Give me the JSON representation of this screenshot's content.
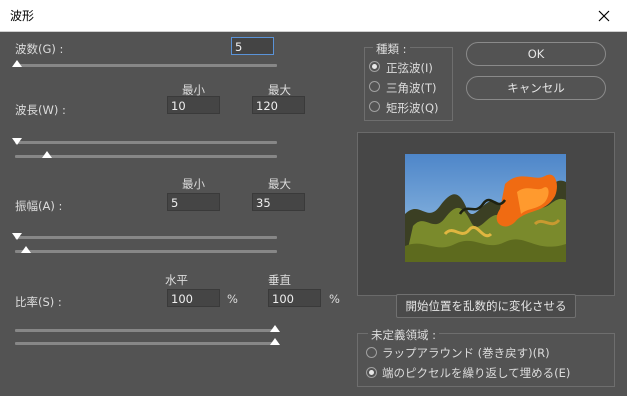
{
  "window": {
    "title": "波形"
  },
  "wave": {
    "generators_label": "波数(G) :",
    "generators_value": "5",
    "wavelength_label": "波長(W) :",
    "amplitude_label": "振幅(A) :",
    "scale_label": "比率(S) :",
    "min_label": "最小",
    "max_label": "最大",
    "wavelength_min": "10",
    "wavelength_max": "120",
    "amplitude_min": "5",
    "amplitude_max": "35",
    "horizontal_label": "水平",
    "vertical_label": "垂直",
    "scale_h": "100",
    "scale_v": "100",
    "percent": "%"
  },
  "type_group": {
    "title": "種類 :",
    "options": [
      "正弦波(I)",
      "三角波(T)",
      "矩形波(Q)"
    ],
    "selected": "正弦波(I)"
  },
  "buttons": {
    "ok": "OK",
    "cancel": "キャンセル",
    "randomize": "開始位置を乱数的に変化させる"
  },
  "undefined_group": {
    "title": "未定義領域 :",
    "options": [
      "ラップアラウンド (巻き戻す)(R)",
      "端のピクセルを繰り返して埋める(E)"
    ],
    "selected": "端のピクセルを繰り返して埋める(E)"
  },
  "colors": {
    "focus": "#5a93d8",
    "background": "#535353"
  },
  "icons": [
    "close-icon"
  ]
}
